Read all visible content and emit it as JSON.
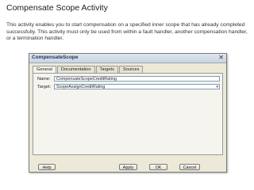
{
  "slide": {
    "title": "Compensate Scope Activity",
    "body": "This activity enables you to start compensation on a specified inner scope that has already completed successfully. This activity must only be used from within a fault handler, another compensation handler, or a termination handler."
  },
  "dialog": {
    "title": "CompensateScope",
    "close_glyph": "✕",
    "tabs": [
      "General",
      "Documentation",
      "Targets",
      "Sources"
    ],
    "active_tab": "General",
    "fields": {
      "name_label": "Name:",
      "name_value": "CompensateScopeCreditRating",
      "target_label": "Target:",
      "target_value": "ScopeAssignCreditRating",
      "dropdown_glyph": "▾"
    },
    "buttons": {
      "help": "Help",
      "apply": "Apply",
      "ok": "OK",
      "cancel": "Cancel"
    }
  }
}
